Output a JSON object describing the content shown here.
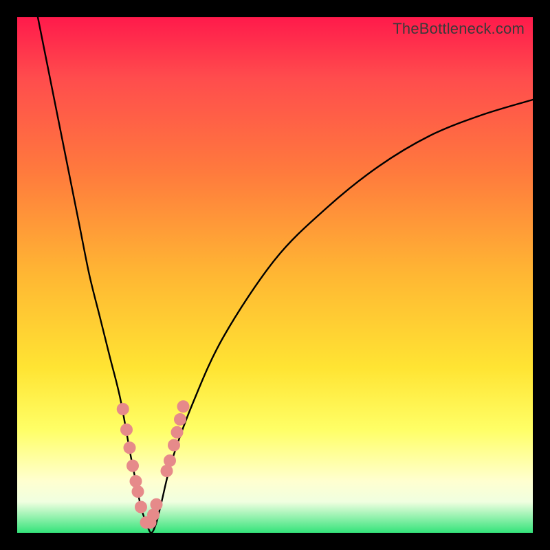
{
  "watermark": "TheBottleneck.com",
  "chart_data": {
    "type": "line",
    "title": "",
    "xlabel": "",
    "ylabel": "",
    "xlim": [
      0,
      100
    ],
    "ylim": [
      0,
      100
    ],
    "series": [
      {
        "name": "bottleneck-curve",
        "x": [
          4,
          6,
          8,
          10,
          12,
          14,
          16,
          18,
          20,
          22,
          23,
          24,
          25,
          26,
          27,
          28,
          30,
          34,
          40,
          50,
          60,
          70,
          80,
          90,
          100
        ],
        "y": [
          100,
          90,
          80,
          70,
          60,
          50,
          42,
          34,
          26,
          15,
          10,
          5,
          2,
          0,
          2,
          6,
          14,
          25,
          38,
          53,
          63,
          71,
          77,
          81,
          84
        ]
      }
    ],
    "markers": {
      "name": "pink-dots",
      "color": "#e68a8a",
      "x": [
        20.5,
        21.2,
        21.8,
        22.4,
        23.0,
        23.4,
        24.0,
        25.0,
        25.8,
        26.4,
        27.0,
        29.0,
        29.6,
        30.4,
        31.0,
        31.6,
        32.2
      ],
      "y": [
        24.0,
        20.0,
        16.5,
        13.0,
        10.0,
        8.0,
        5.0,
        2.0,
        2.0,
        3.5,
        5.5,
        12.0,
        14.0,
        17.0,
        19.5,
        22.0,
        24.5
      ]
    }
  }
}
